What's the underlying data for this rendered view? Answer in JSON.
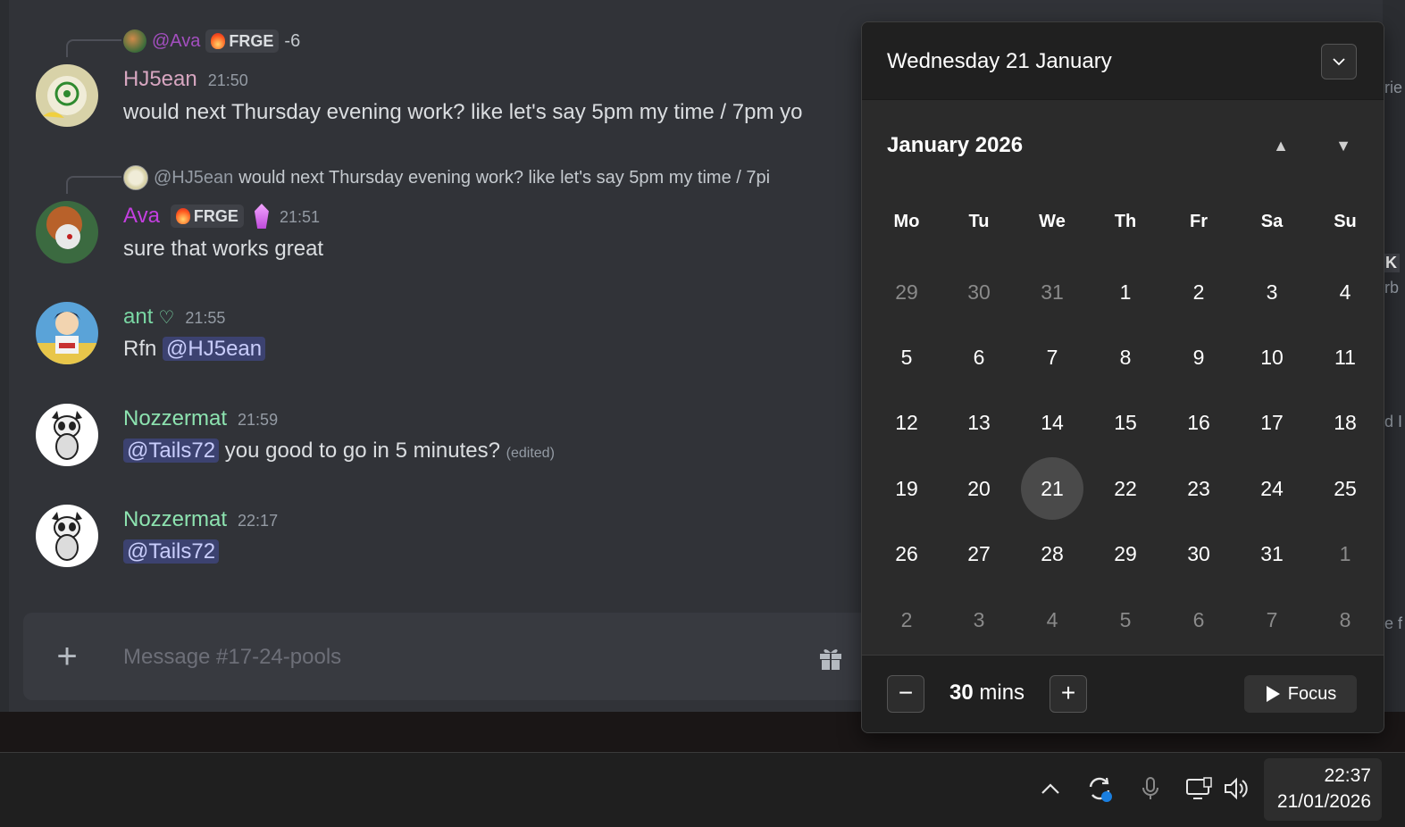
{
  "messages": [
    {
      "reply": {
        "name": "@Ava",
        "tag": "FRGE",
        "text": "-6"
      },
      "username": "HJ5ean",
      "username_color": "#d7a6c0",
      "time": "21:50",
      "text": "would next Thursday evening work? like let's say 5pm my time / 7pm yo"
    },
    {
      "reply": {
        "name": "@HJ5ean",
        "text": "would next Thursday evening work? like let's say 5pm my time / 7pi"
      },
      "username": "Ava",
      "username_color": "#c43fe0",
      "tag": "FRGE",
      "time": "21:51",
      "text": "sure that works great"
    },
    {
      "username": "ant",
      "username_color": "#79d6a3",
      "heart": "♡",
      "time": "21:55",
      "text_prefix": "Rfn",
      "mention": "@HJ5ean"
    },
    {
      "username": "Nozzermat",
      "username_color": "#8de3b0",
      "time": "21:59",
      "mention": "@Tails72",
      "text": "you good to go in 5 minutes?",
      "edited": "(edited)"
    },
    {
      "username": "Nozzermat",
      "username_color": "#8de3b0",
      "time": "22:17",
      "mention": "@Tails72"
    }
  ],
  "composer": {
    "placeholder": "Message #17-24-pools"
  },
  "right_strip": {
    "frag1": "rie",
    "frag2": "K",
    "frag3": "rb",
    "frag4": "d I",
    "frag5": "e f"
  },
  "calendar": {
    "header_date": "Wednesday 21 January",
    "month_label": "January 2026",
    "weekdays": [
      "Mo",
      "Tu",
      "We",
      "Th",
      "Fr",
      "Sa",
      "Su"
    ],
    "weeks": [
      [
        [
          "29",
          true
        ],
        [
          "30",
          true
        ],
        [
          "31",
          true
        ],
        [
          "1",
          false
        ],
        [
          "2",
          false
        ],
        [
          "3",
          false
        ],
        [
          "4",
          false
        ]
      ],
      [
        [
          "5",
          false
        ],
        [
          "6",
          false
        ],
        [
          "7",
          false
        ],
        [
          "8",
          false
        ],
        [
          "9",
          false
        ],
        [
          "10",
          false
        ],
        [
          "11",
          false
        ]
      ],
      [
        [
          "12",
          false
        ],
        [
          "13",
          false
        ],
        [
          "14",
          false
        ],
        [
          "15",
          false
        ],
        [
          "16",
          false
        ],
        [
          "17",
          false
        ],
        [
          "18",
          false
        ]
      ],
      [
        [
          "19",
          false
        ],
        [
          "20",
          false
        ],
        [
          "21",
          false
        ],
        [
          "22",
          false
        ],
        [
          "23",
          false
        ],
        [
          "24",
          false
        ],
        [
          "25",
          false
        ]
      ],
      [
        [
          "26",
          false
        ],
        [
          "27",
          false
        ],
        [
          "28",
          false
        ],
        [
          "29",
          false
        ],
        [
          "30",
          false
        ],
        [
          "31",
          false
        ],
        [
          "1",
          true
        ]
      ],
      [
        [
          "2",
          true
        ],
        [
          "3",
          true
        ],
        [
          "4",
          true
        ],
        [
          "5",
          true
        ],
        [
          "6",
          true
        ],
        [
          "7",
          true
        ],
        [
          "8",
          true
        ]
      ]
    ],
    "selected_day": "21",
    "focus": {
      "value": "30",
      "unit": "mins",
      "button_label": "Focus"
    }
  },
  "taskbar": {
    "time": "22:37",
    "date": "21/01/2026",
    "icons": [
      "chevron-up-icon",
      "sync-icon",
      "microphone-icon",
      "network-icon",
      "speaker-icon"
    ]
  }
}
